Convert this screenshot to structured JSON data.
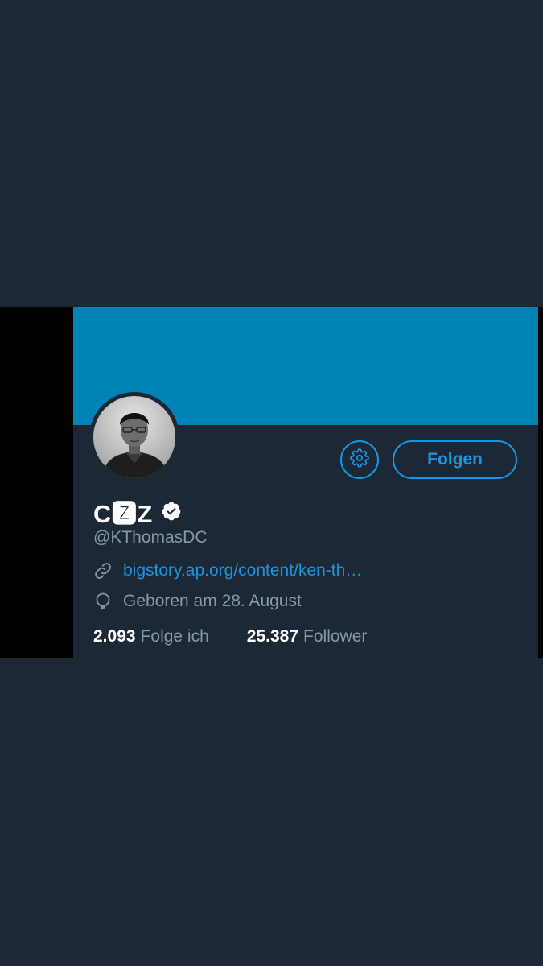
{
  "profile": {
    "display_name": "C🆉Z",
    "handle": "@KThomasDC",
    "verified": true,
    "website": "bigstory.ap.org/content/ken-th…",
    "birthday": "Geboren am 28. August"
  },
  "actions": {
    "settings_icon": "gear-icon",
    "follow_label": "Folgen"
  },
  "stats": {
    "following_count": "2.093",
    "following_label": "Folge ich",
    "followers_count": "25.387",
    "followers_label": "Follower"
  },
  "icons": {
    "link": "link-icon",
    "birthday": "balloon-icon",
    "verified": "verified-badge-icon"
  },
  "colors": {
    "background": "#1c2835",
    "banner": "#0283b8",
    "accent": "#1b95e0",
    "secondary_text": "#8899a6",
    "primary_text": "#ffffff"
  }
}
